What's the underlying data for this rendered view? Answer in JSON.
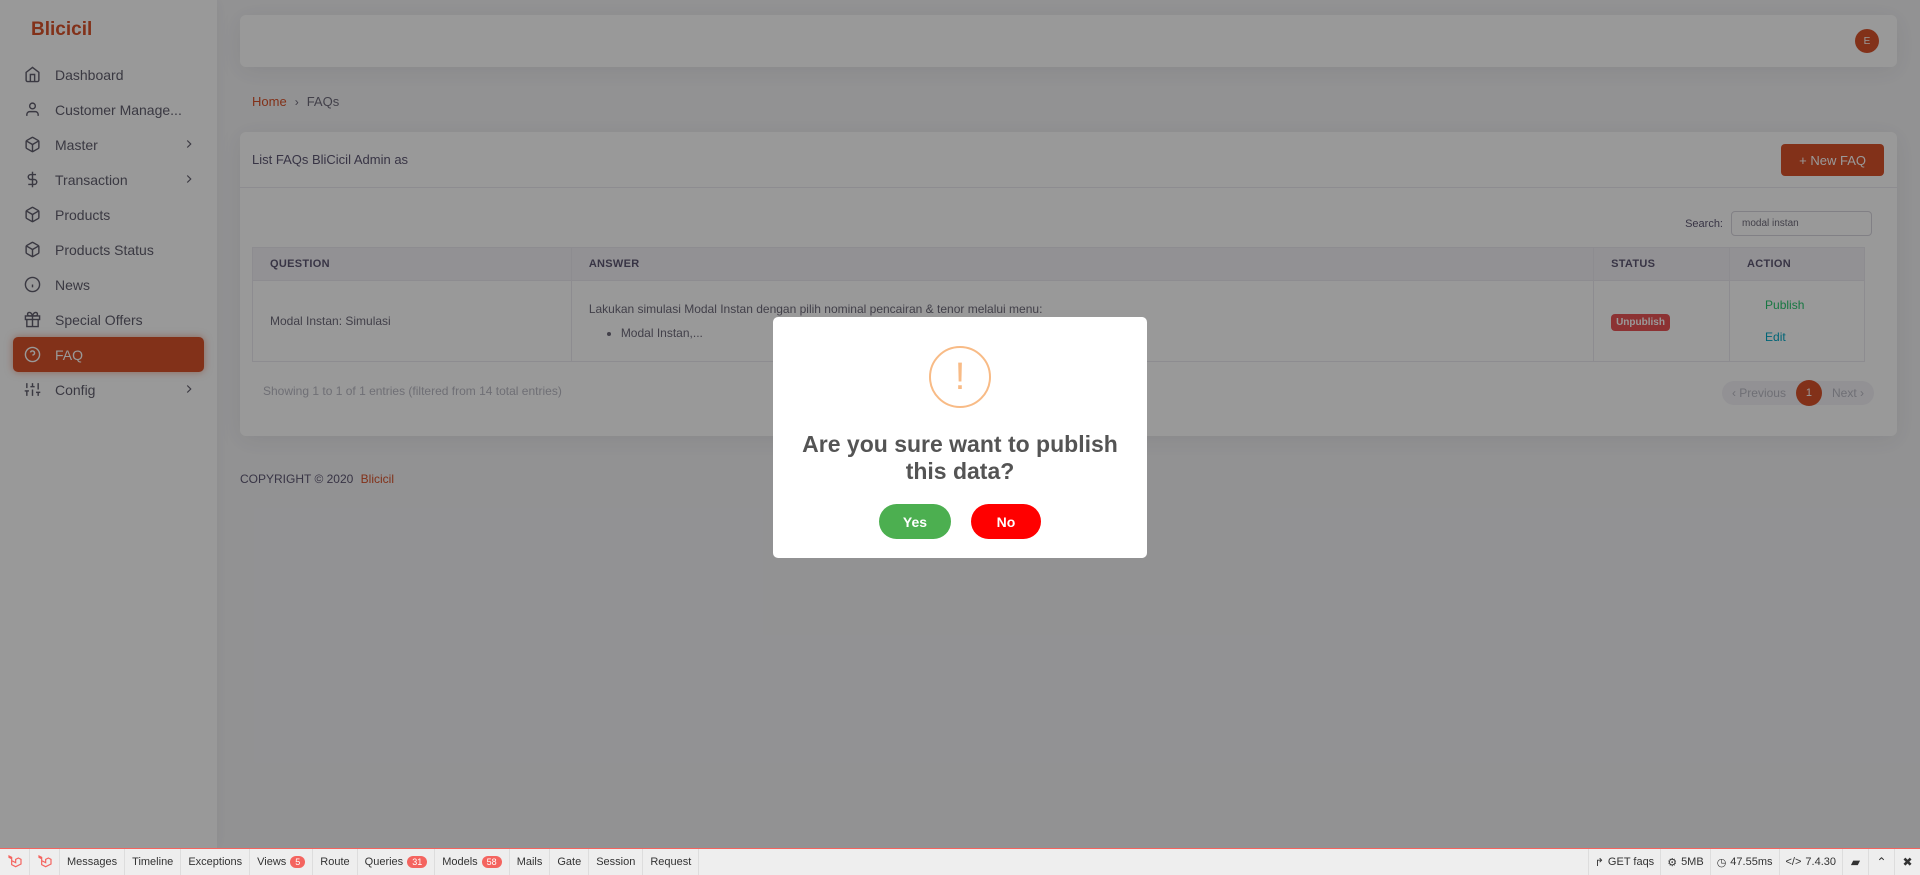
{
  "app": {
    "brand": "Blicicil",
    "avatar_initial": "E"
  },
  "sidebar": {
    "items": [
      {
        "label": "Dashboard",
        "icon": "home-icon",
        "has_children": false,
        "active": false
      },
      {
        "label": "Customer Manage...",
        "icon": "user-icon",
        "has_children": false,
        "active": false
      },
      {
        "label": "Master",
        "icon": "box-icon",
        "has_children": true,
        "active": false
      },
      {
        "label": "Transaction",
        "icon": "dollar-icon",
        "has_children": true,
        "active": false
      },
      {
        "label": "Products",
        "icon": "box-icon",
        "has_children": false,
        "active": false
      },
      {
        "label": "Products Status",
        "icon": "box-icon",
        "has_children": false,
        "active": false
      },
      {
        "label": "News",
        "icon": "info-icon",
        "has_children": false,
        "active": false
      },
      {
        "label": "Special Offers",
        "icon": "gift-icon",
        "has_children": false,
        "active": false
      },
      {
        "label": "FAQ",
        "icon": "help-circle-icon",
        "has_children": false,
        "active": true
      },
      {
        "label": "Config",
        "icon": "sliders-icon",
        "has_children": true,
        "active": false
      }
    ]
  },
  "breadcrumb": {
    "home": "Home",
    "current": "FAQs"
  },
  "card": {
    "title": "List FAQs BliCicil Admin as",
    "new_button": "+ New FAQ",
    "search_label": "Search:",
    "search_value": "modal instan"
  },
  "table": {
    "headers": [
      "QUESTION",
      "ANSWER",
      "STATUS",
      "ACTION"
    ],
    "rows": [
      {
        "question": "Modal Instan: Simulasi",
        "answer_text": "Lakukan simulasi Modal Instan dengan pilih nominal pencairan & tenor melalui menu:",
        "answer_bullet": "Modal Instan,...",
        "status": "Unpublish",
        "action_publish": "Publish",
        "action_edit": "Edit"
      }
    ]
  },
  "pagination": {
    "info": "Showing 1 to 1 of 1 entries (filtered from 14 total entries)",
    "previous": "‹ Previous",
    "current_page": "1",
    "next": "Next ›"
  },
  "footer": {
    "copyright": "COPYRIGHT © 2020",
    "brand": "Blicicil"
  },
  "modal": {
    "icon_glyph": "!",
    "title": "Are you sure want to publish this data?",
    "yes": "Yes",
    "no": "No"
  },
  "debugbar": {
    "tabs": [
      {
        "label": "Messages"
      },
      {
        "label": "Timeline"
      },
      {
        "label": "Exceptions"
      },
      {
        "label": "Views",
        "count": "5"
      },
      {
        "label": "Route"
      },
      {
        "label": "Queries",
        "count": "31"
      },
      {
        "label": "Models",
        "count": "58"
      },
      {
        "label": "Mails"
      },
      {
        "label": "Gate"
      },
      {
        "label": "Session"
      },
      {
        "label": "Request"
      }
    ],
    "request": "GET faqs",
    "memory": "5MB",
    "time": "47.55ms",
    "php_version": "7.4.30"
  },
  "colors": {
    "accent": "#d9532b",
    "success": "#28c76f",
    "danger": "#ea5455"
  }
}
